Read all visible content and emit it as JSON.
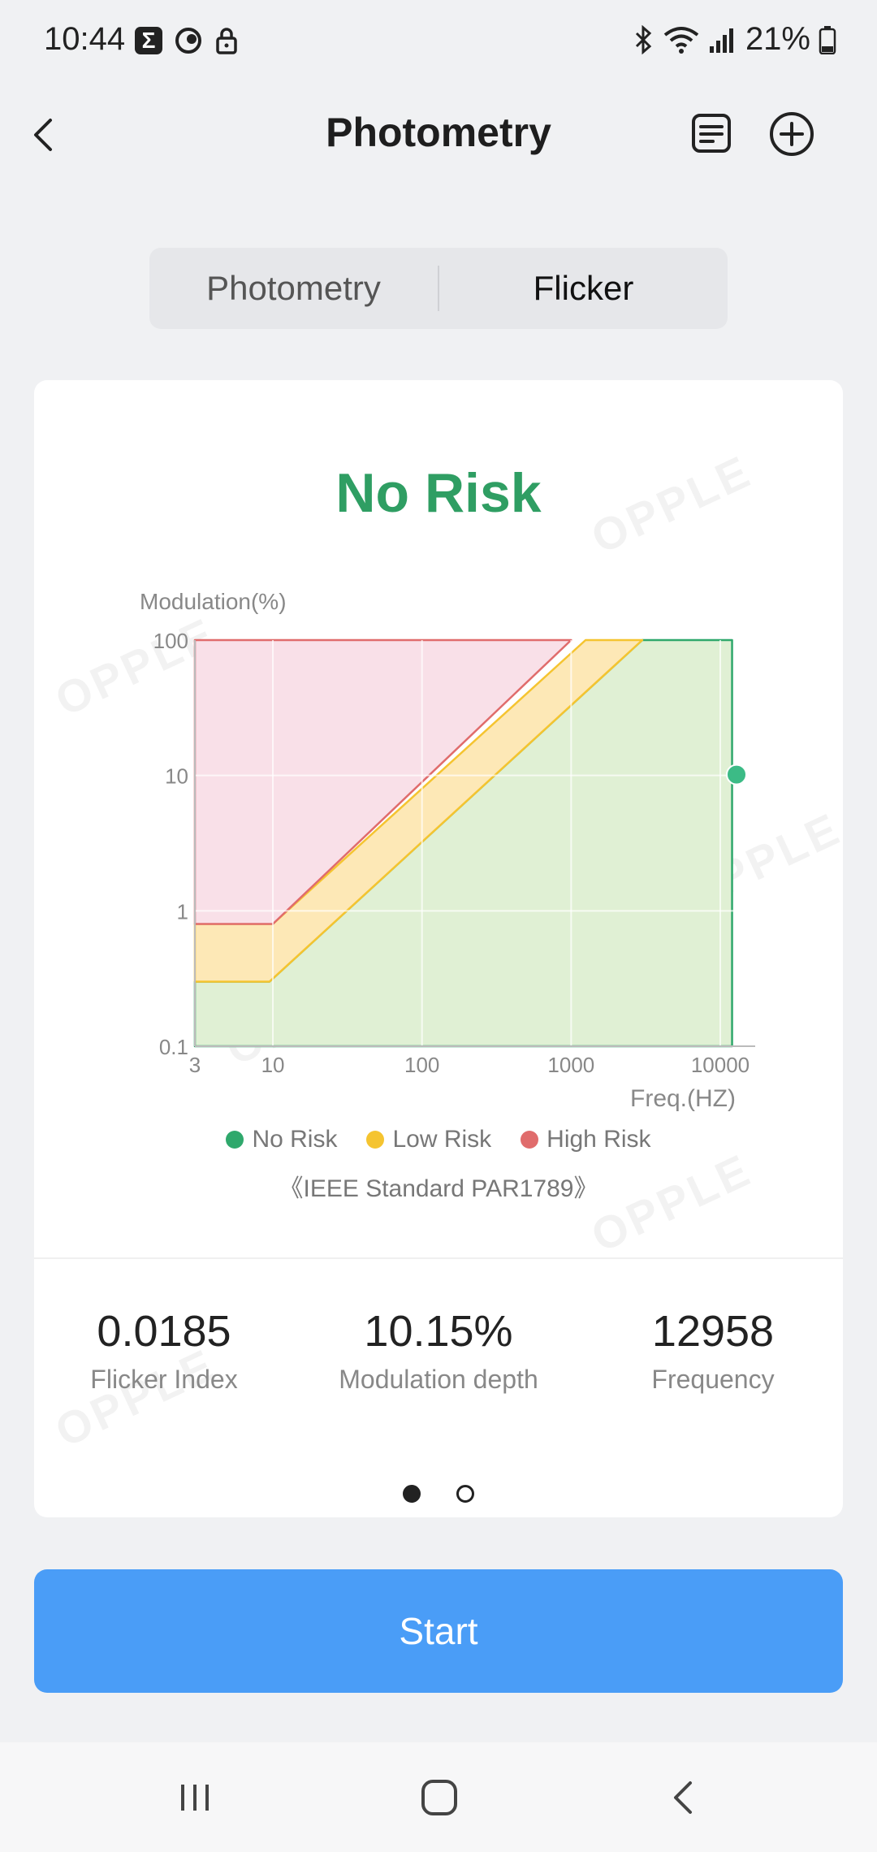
{
  "status_bar": {
    "time": "10:44",
    "battery": "21%",
    "left_icons": [
      "sigma-icon",
      "c-logo-icon",
      "lock-icon"
    ],
    "right_icons": [
      "bluetooth-icon",
      "wifi-icon",
      "signal-icon",
      "battery-icon"
    ]
  },
  "header": {
    "title": "Photometry"
  },
  "tabs": [
    {
      "label": "Photometry",
      "active": false
    },
    {
      "label": "Flicker",
      "active": true
    }
  ],
  "result": {
    "risk_label": "No Risk",
    "risk_color": "#2f9e63",
    "watermark": "OPPLE"
  },
  "chart_data": {
    "type": "area",
    "title": "",
    "ylabel": "Modulation(%)",
    "xlabel": "Freq.(HZ)",
    "x_scale": "log",
    "y_scale": "log",
    "xlim": [
      3,
      10000
    ],
    "ylim": [
      0.1,
      100
    ],
    "x_ticks": [
      "3",
      "10",
      "100",
      "1000",
      "10000"
    ],
    "y_ticks": [
      "100",
      "10",
      "1",
      "0.1"
    ],
    "regions": [
      {
        "name": "No Risk",
        "color": "#2fa86c",
        "fill": "#e0f0d4",
        "boundary": [
          [
            3,
            0.3
          ],
          [
            9.5,
            0.3
          ],
          [
            3000,
            100
          ],
          [
            12000,
            100
          ],
          [
            12000,
            0.1
          ],
          [
            3,
            0.1
          ]
        ]
      },
      {
        "name": "Low Risk",
        "color": "#f5c430",
        "fill": "#fde8b6",
        "boundary": [
          [
            3,
            0.8
          ],
          [
            10,
            0.8
          ],
          [
            1250,
            100
          ],
          [
            3000,
            100
          ],
          [
            9.5,
            0.3
          ],
          [
            3,
            0.3
          ]
        ]
      },
      {
        "name": "High Risk",
        "color": "#e06c6c",
        "fill": "#f9e0e8",
        "boundary": [
          [
            3,
            100
          ],
          [
            1000,
            100
          ],
          [
            10,
            0.8
          ],
          [
            3,
            0.8
          ]
        ]
      }
    ],
    "measurement": {
      "x": 10000,
      "y": 10.15,
      "color": "#3cbb86"
    },
    "grid": true
  },
  "legend": [
    {
      "label": "No Risk",
      "color": "#2fa86c"
    },
    {
      "label": "Low Risk",
      "color": "#f5c430"
    },
    {
      "label": "High Risk",
      "color": "#e06c6c"
    }
  ],
  "standard_text": "《IEEE Standard PAR1789》",
  "metrics": [
    {
      "value": "0.0185",
      "label": "Flicker Index"
    },
    {
      "value": "10.15%",
      "label": "Modulation depth"
    },
    {
      "value": "12958",
      "label": "Frequency"
    }
  ],
  "pager": {
    "count": 2,
    "active": 0
  },
  "start_button": {
    "label": "Start"
  }
}
